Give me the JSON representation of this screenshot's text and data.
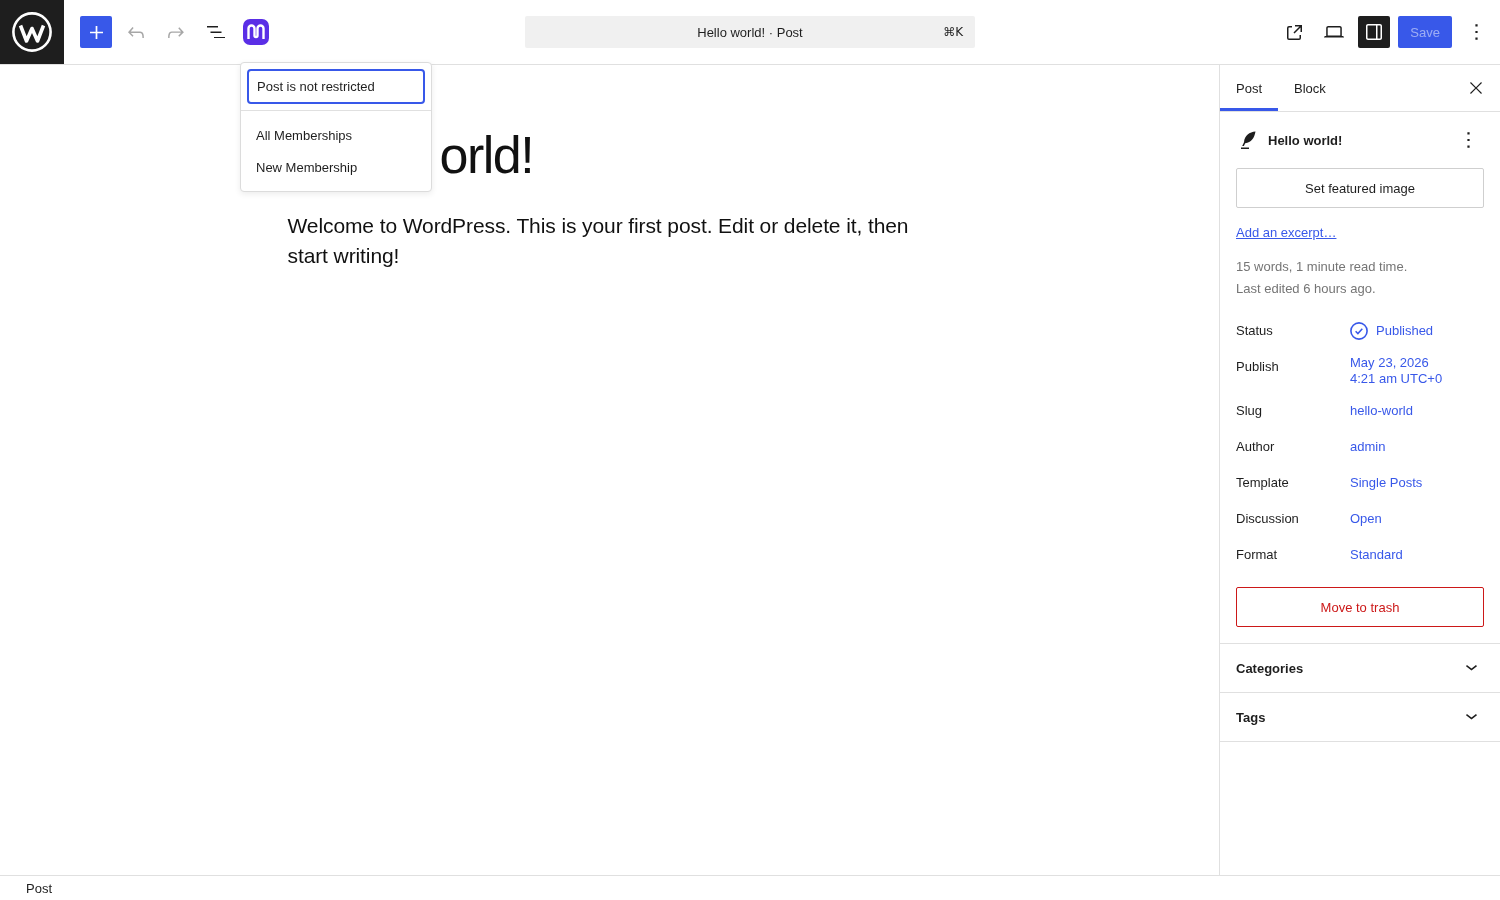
{
  "top_bar": {
    "tools": [
      {
        "kind": "add",
        "disabled": false
      },
      {
        "kind": "undo",
        "disabled": true
      },
      {
        "kind": "redo",
        "disabled": true
      },
      {
        "kind": "list_view",
        "disabled": false
      },
      {
        "kind": "membership",
        "disabled": false
      }
    ],
    "command_bar": {
      "title": "Hello world! · Post",
      "shortcut": "⌘K"
    },
    "actions": [
      {
        "kind": "view",
        "pressed": false
      },
      {
        "kind": "preview",
        "pressed": false
      },
      {
        "kind": "settings",
        "pressed": true
      }
    ],
    "save_button": {
      "label": "Save",
      "disabled": true
    }
  },
  "membership_popover": {
    "status_button": {
      "label": "Post is not restricted",
      "focused": true
    },
    "items": [
      {
        "label": "All Memberships"
      },
      {
        "label": "New Membership"
      }
    ]
  },
  "editor": {
    "title": "orld!",
    "paragraph": "Welcome to WordPress. This is your first post. Edit or delete it, then start writing!"
  },
  "sidebar": {
    "tabs": [
      {
        "label": "Post",
        "selected": true
      },
      {
        "label": "Block",
        "selected": false
      }
    ],
    "post_title": "Hello world!",
    "featured_image_button": "Set featured image",
    "excerpt_link": "Add an excerpt…",
    "stats": [
      "15 words, 1 minute read time.",
      "Last edited 6 hours ago."
    ],
    "fields": [
      {
        "label": "Status",
        "value": "Published",
        "kind": "status"
      },
      {
        "label": "Publish",
        "value": "May 23, 2026 4:21 am UTC+0",
        "kind": "link"
      },
      {
        "label": "Slug",
        "value": "hello-world",
        "kind": "link"
      },
      {
        "label": "Author",
        "value": "admin",
        "kind": "link"
      },
      {
        "label": "Template",
        "value": "Single Posts",
        "kind": "link"
      },
      {
        "label": "Discussion",
        "value": "Open",
        "kind": "link"
      },
      {
        "label": "Format",
        "value": "Standard",
        "kind": "link"
      }
    ],
    "trash_button": "Move to trash",
    "panels": [
      {
        "title": "Categories",
        "expanded": false
      },
      {
        "title": "Tags",
        "expanded": false
      }
    ]
  },
  "footer": {
    "breadcrumb": "Post"
  }
}
